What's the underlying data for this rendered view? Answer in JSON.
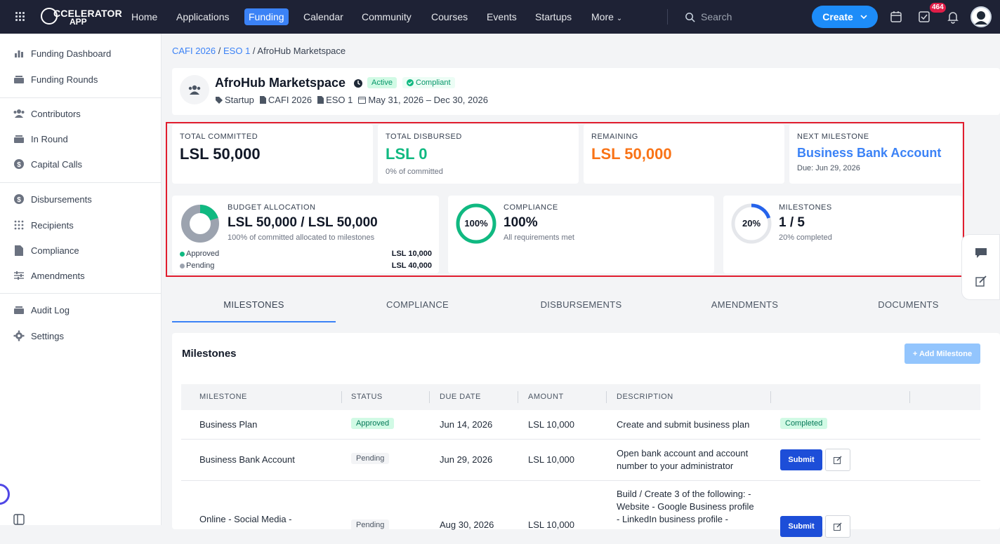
{
  "topbar": {
    "logo_line1": "CCELERATOR",
    "logo_line2": "APP",
    "nav": [
      "Home",
      "Applications",
      "Funding",
      "Calendar",
      "Community",
      "Courses",
      "Events",
      "Startups",
      "More"
    ],
    "active_nav": "Funding",
    "search_placeholder": "Search",
    "create_label": "Create",
    "notification_count": "464"
  },
  "sidebar": {
    "items": [
      {
        "label": "Funding Dashboard",
        "icon": "bar-chart-icon"
      },
      {
        "label": "Funding Rounds",
        "icon": "layers-icon"
      },
      {
        "label": "Contributors",
        "icon": "users-icon"
      },
      {
        "label": "In Round",
        "icon": "layers-icon"
      },
      {
        "label": "Capital Calls",
        "icon": "dollar-icon"
      },
      {
        "label": "Disbursements",
        "icon": "dollar-icon"
      },
      {
        "label": "Recipients",
        "icon": "grid-icon"
      },
      {
        "label": "Compliance",
        "icon": "file-icon"
      },
      {
        "label": "Amendments",
        "icon": "sliders-icon"
      },
      {
        "label": "Audit Log",
        "icon": "layers-icon"
      },
      {
        "label": "Settings",
        "icon": "gear-icon"
      }
    ]
  },
  "breadcrumb": {
    "a": "CAFI 2026",
    "b": "ESO 1",
    "current": "AfroHub Marketspace"
  },
  "header": {
    "title": "AfroHub Marketspace",
    "status": "Active",
    "compliance": "Compliant",
    "type": "Startup",
    "program": "CAFI 2026",
    "eso": "ESO 1",
    "dates": "May 31, 2026 – Dec 30, 2026"
  },
  "stats": {
    "committed": {
      "label": "TOTAL COMMITTED",
      "value": "LSL 50,000"
    },
    "disbursed": {
      "label": "TOTAL DISBURSED",
      "value": "LSL 0",
      "sub": "0% of committed"
    },
    "remaining": {
      "label": "REMAINING",
      "value": "LSL 50,000"
    },
    "next": {
      "label": "NEXT MILESTONE",
      "value": "Business Bank Account",
      "sub": "Due: Jun 29, 2026"
    }
  },
  "budget": {
    "label": "BUDGET ALLOCATION",
    "value": "LSL 50,000 / LSL 50,000",
    "sub": "100% of committed allocated to milestones",
    "approved_label": "Approved",
    "approved_value": "LSL 10,000",
    "pending_label": "Pending",
    "pending_value": "LSL 40,000",
    "approved_fraction": 0.2,
    "colors": {
      "approved": "#10b981",
      "pending": "#9ca3af"
    }
  },
  "compliance_card": {
    "label": "COMPLIANCE",
    "value": "100%",
    "ring_text": "100%",
    "sub": "All requirements met",
    "fraction": 1.0,
    "color": "#10b981"
  },
  "milestones_card": {
    "label": "MILESTONES",
    "value": "1 / 5",
    "ring_text": "20%",
    "sub": "20% completed",
    "fraction": 0.2,
    "color": "#2563eb"
  },
  "tabs": [
    "MILESTONES",
    "COMPLIANCE",
    "DISBURSEMENTS",
    "AMENDMENTS",
    "DOCUMENTS"
  ],
  "milestones": {
    "title": "Milestones",
    "add_label": "+ Add Milestone",
    "columns": [
      "MILESTONE",
      "STATUS",
      "DUE DATE",
      "AMOUNT",
      "DESCRIPTION"
    ],
    "rows": [
      {
        "name": "Business Plan",
        "status": "Approved",
        "due": "Jun 14, 2026",
        "amount": "LSL 10,000",
        "desc1": "Create and submit business plan",
        "desc2": "",
        "action": "Completed"
      },
      {
        "name": "Business Bank Account",
        "status": "Pending",
        "due": "Jun 29, 2026",
        "amount": "LSL 10,000",
        "desc1": "Open bank account and account",
        "desc2": "number to your administrator",
        "action": "Submit"
      },
      {
        "name": "Online - Social Media -",
        "status": "Pending",
        "due": "Aug 30, 2026",
        "amount": "LSL 10,000",
        "desc1": "Build / Create 3 of the following: -",
        "desc2": "Website - Google Business profile",
        "desc3": "- LinkedIn business profile -",
        "action": "Submit"
      }
    ]
  }
}
